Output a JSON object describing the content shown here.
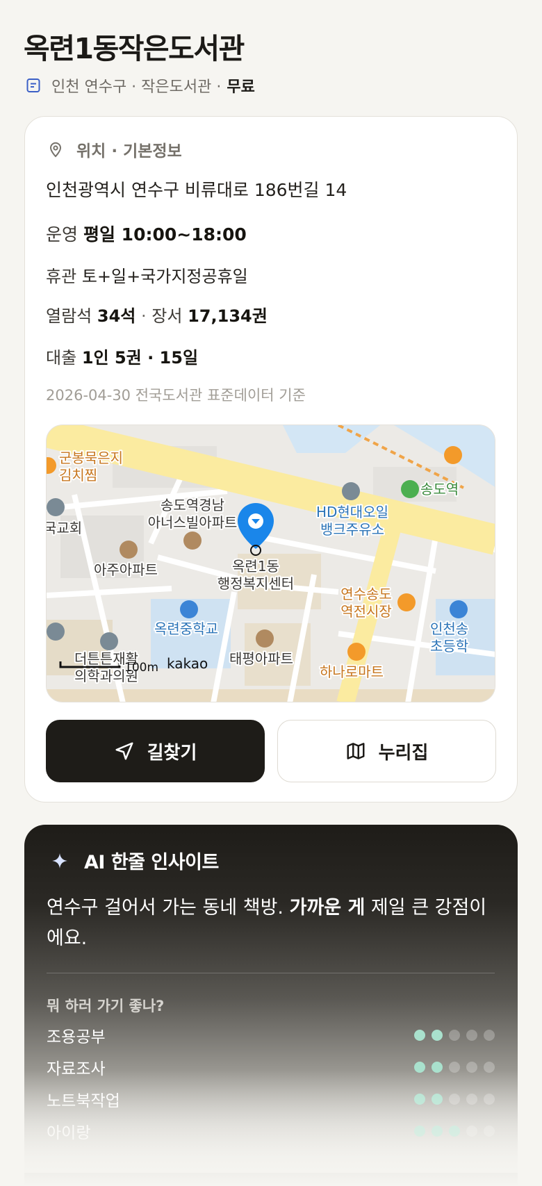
{
  "header": {
    "title": "옥련1동작은도서관",
    "meta": "인천 연수구 · 작은도서관 ·",
    "fee": "무료"
  },
  "info": {
    "section_title": "위치 · 기본정보",
    "address": "인천광역시 연수구 비류대로 186번길 14",
    "hours_label": "운영",
    "hours_value": "평일 10:00~18:00",
    "closed_label": "휴관",
    "closed_value": "토+일+국가지정공휴일",
    "seats_label": "열람석",
    "seats_value": "34석",
    "books_label": "장서",
    "books_value": "17,134권",
    "loan_label": "대출",
    "loan_value": "1인 5권 · 15일",
    "source": "2026-04-30 전국도서관 표준데이터 기준"
  },
  "map": {
    "labels": {
      "restaurant": "군봉묵은지\n김치찜",
      "apt_songdo": "송도역경남\n아너스빌아파트",
      "hd_oil": "HD현대오일\n뱅크주유소",
      "songdo_station": "송도역",
      "church": "국교회",
      "aju": "아주아파트",
      "center": "옥련1동\n행정복지센터",
      "market": "연수송도\n역전시장",
      "school": "옥련중학교",
      "elementary": "인천송\n초등학",
      "clinic": "더튼튼재활\n의학과의원",
      "taepyeong": "태평아파트",
      "hanaro": "하나로마트"
    },
    "scale": "100m",
    "brand": "kakao"
  },
  "buttons": {
    "directions": "길찾기",
    "nurizip": "누리집"
  },
  "ai": {
    "title": "AI 한줄 인사이트",
    "text_pre": "연수구 걸어서 가는 동네 책방. ",
    "text_bold": "가까운 게",
    "text_post": " 제일 큰 강점이에요.",
    "question": "뭐 하러 가기 좋나?",
    "items": [
      {
        "name": "조용공부",
        "score": 2
      },
      {
        "name": "자료조사",
        "score": 2
      },
      {
        "name": "노트북작업",
        "score": 2
      },
      {
        "name": "아이랑",
        "score": 3
      }
    ],
    "max_score": 5
  },
  "colors": {
    "accent_pin": "#1a86ea",
    "dot_on": "#a9e1cd",
    "dark": "#1e1c18"
  }
}
